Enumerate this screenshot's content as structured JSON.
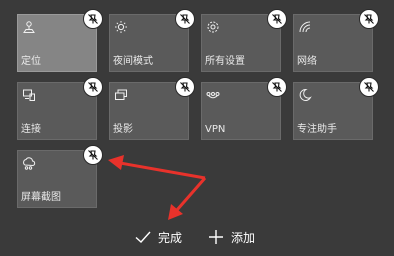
{
  "tiles": [
    {
      "label": "定位",
      "icon": "location-icon",
      "active": true
    },
    {
      "label": "夜间模式",
      "icon": "night-light-icon",
      "active": false
    },
    {
      "label": "所有设置",
      "icon": "settings-icon",
      "active": false
    },
    {
      "label": "网络",
      "icon": "network-icon",
      "active": false
    },
    {
      "label": "连接",
      "icon": "connect-icon",
      "active": false
    },
    {
      "label": "投影",
      "icon": "project-icon",
      "active": false
    },
    {
      "label": "VPN",
      "icon": "vpn-icon",
      "active": false
    },
    {
      "label": "专注助手",
      "icon": "focus-assist-icon",
      "active": false
    },
    {
      "label": "屏幕截图",
      "icon": "screen-snip-icon",
      "active": false
    }
  ],
  "actions": {
    "done_label": "完成",
    "add_label": "添加"
  },
  "colors": {
    "background": "#3a3a3a",
    "tile": "#5a5a5a",
    "tile_active": "#858585",
    "annotation_arrow": "#e8322b"
  }
}
